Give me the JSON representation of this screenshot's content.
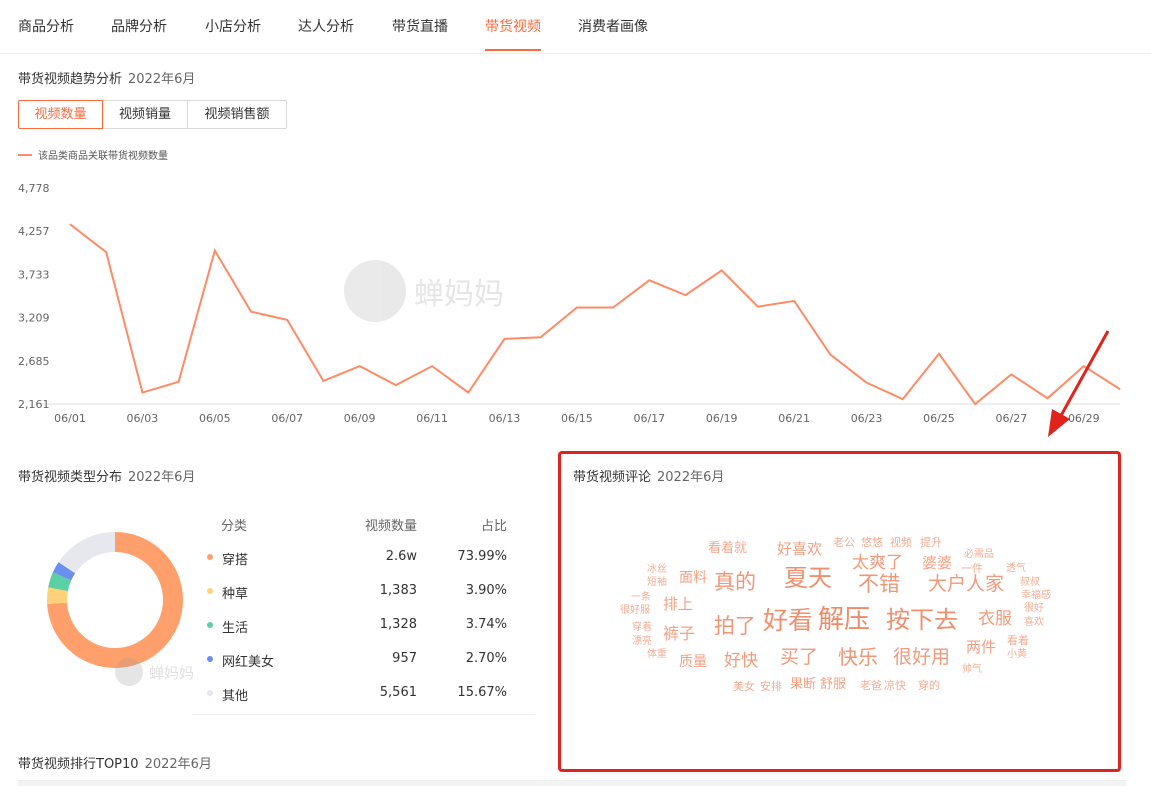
{
  "tabs": [
    {
      "label": "商品分析",
      "active": false
    },
    {
      "label": "品牌分析",
      "active": false
    },
    {
      "label": "小店分析",
      "active": false
    },
    {
      "label": "达人分析",
      "active": false
    },
    {
      "label": "带货直播",
      "active": false
    },
    {
      "label": "带货视频",
      "active": true
    },
    {
      "label": "消费者画像",
      "active": false
    }
  ],
  "trend": {
    "title": "带货视频趋势分析",
    "date": "2022年6月",
    "buttons": [
      {
        "label": "视频数量",
        "active": true
      },
      {
        "label": "视频销量",
        "active": false
      },
      {
        "label": "视频销售额",
        "active": false
      }
    ],
    "legend": "该品类商品关联带货视频数量"
  },
  "watermark": "蝉妈妈",
  "chart_data": {
    "type": "line",
    "title": "",
    "xlabel": "",
    "ylabel": "",
    "ylim": [
      2161,
      4778
    ],
    "yticks": [
      "4,778",
      "4,257",
      "3,733",
      "3,209",
      "2,685",
      "2,161"
    ],
    "xticks": [
      "06/01",
      "06/03",
      "06/05",
      "06/07",
      "06/09",
      "06/11",
      "06/13",
      "06/15",
      "06/17",
      "06/19",
      "06/21",
      "06/23",
      "06/25",
      "06/27",
      "06/29"
    ],
    "x": [
      "06/01",
      "06/02",
      "06/03",
      "06/04",
      "06/05",
      "06/06",
      "06/07",
      "06/08",
      "06/09",
      "06/10",
      "06/11",
      "06/12",
      "06/13",
      "06/14",
      "06/15",
      "06/16",
      "06/17",
      "06/18",
      "06/19",
      "06/20",
      "06/21",
      "06/22",
      "06/23",
      "06/24",
      "06/25",
      "06/26",
      "06/27",
      "06/28",
      "06/29",
      "06/30"
    ],
    "series": [
      {
        "name": "该品类商品关联带货视频数量",
        "color": "#ff8a65",
        "values": [
          4340,
          4000,
          2300,
          2430,
          4020,
          3280,
          3180,
          2440,
          2620,
          2390,
          2620,
          2300,
          2950,
          2970,
          3330,
          3330,
          3660,
          3480,
          3780,
          3340,
          3410,
          2760,
          2420,
          2220,
          2770,
          2160,
          2520,
          2230,
          2620,
          2340
        ]
      }
    ],
    "grid": false
  },
  "distribution": {
    "title": "带货视频类型分布",
    "date": "2022年6月",
    "headers": {
      "category": "分类",
      "count": "视频数量",
      "pct": "占比"
    },
    "rows": [
      {
        "category": "穿搭",
        "count": "2.6w",
        "pct": "73.99%",
        "share": 73.99,
        "color": "#ff9f6b"
      },
      {
        "category": "种草",
        "count": "1,383",
        "pct": "3.90%",
        "share": 3.9,
        "color": "#ffd27a"
      },
      {
        "category": "生活",
        "count": "1,328",
        "pct": "3.74%",
        "share": 3.74,
        "color": "#5ccfa4"
      },
      {
        "category": "网红美女",
        "count": "957",
        "pct": "2.70%",
        "share": 2.7,
        "color": "#6a8ff0"
      },
      {
        "category": "其他",
        "count": "5,561",
        "pct": "15.67%",
        "share": 15.67,
        "color": "#e6e8ee"
      }
    ]
  },
  "comments": {
    "title": "带货视频评论",
    "date": "2022年6月",
    "words": [
      "看着就",
      "好喜欢",
      "老公",
      "悠悠",
      "视频",
      "提升",
      "冰丝",
      "短袖",
      "面料",
      "真的",
      "夏天",
      "太爽了",
      "婆婆",
      "必需品",
      "一件",
      "透气",
      "一条",
      "排上",
      "不错",
      "大户人家",
      "叔叔",
      "幸福感",
      "很好服",
      "拍了",
      "好看",
      "解压",
      "按下去",
      "衣服",
      "很好",
      "穿着",
      "裤子",
      "喜欢",
      "漂亮",
      "体重",
      "质量",
      "好快",
      "买了",
      "快乐",
      "很好用",
      "两件",
      "看着",
      "小黄",
      "帅气",
      "美女",
      "安排",
      "果断",
      "舒服",
      "老爸",
      "凉快",
      "穿的"
    ]
  },
  "ranking": {
    "title": "带货视频排行TOP10",
    "date": "2022年6月"
  }
}
